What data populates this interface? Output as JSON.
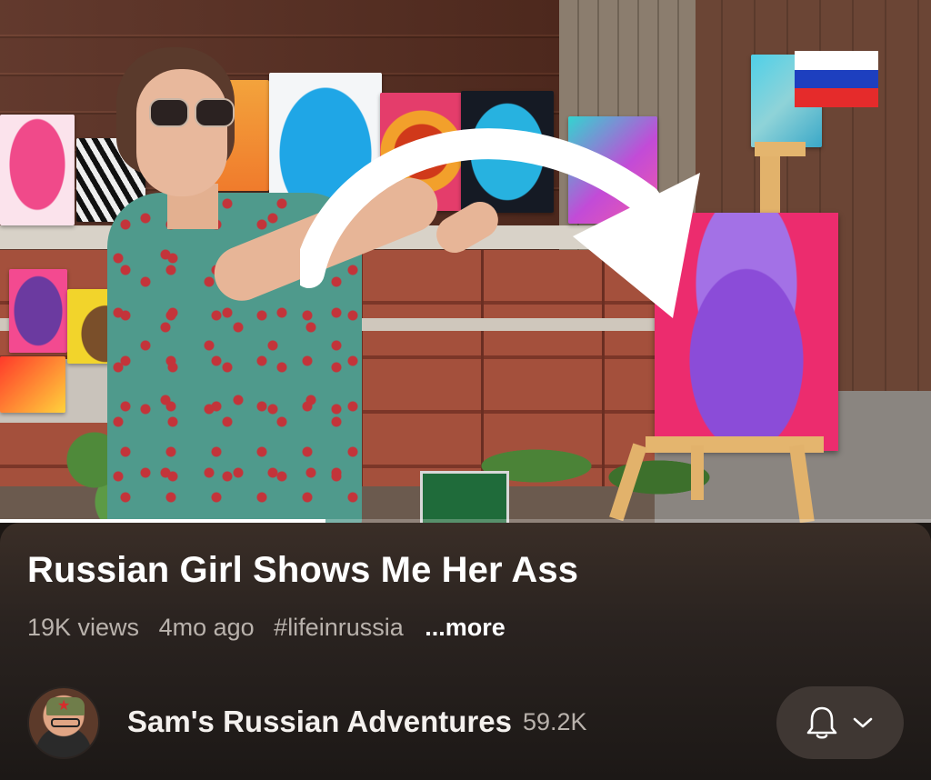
{
  "video": {
    "progress_fraction": 0.35,
    "flag_colors": [
      "#ffffff",
      "#1d3fbf",
      "#e52b2b"
    ],
    "flag_icon": "russia-flag-icon"
  },
  "info": {
    "title": "Russian Girl Shows Me Her Ass",
    "views": "19K views",
    "age": "4mo ago",
    "hashtag": "#lifeinrussia",
    "more_label": "...more"
  },
  "channel": {
    "name": "Sam's Russian Adventures",
    "subscribers": "59.2K",
    "avatar_icon": "channel-avatar",
    "subscribe_icons": [
      "bell-icon",
      "chevron-down-icon"
    ]
  },
  "colors": {
    "panel_bg": "#2a2320",
    "title_text": "#ffffff",
    "meta_text": "#b9b2ac",
    "button_bg": "#3f3733"
  }
}
